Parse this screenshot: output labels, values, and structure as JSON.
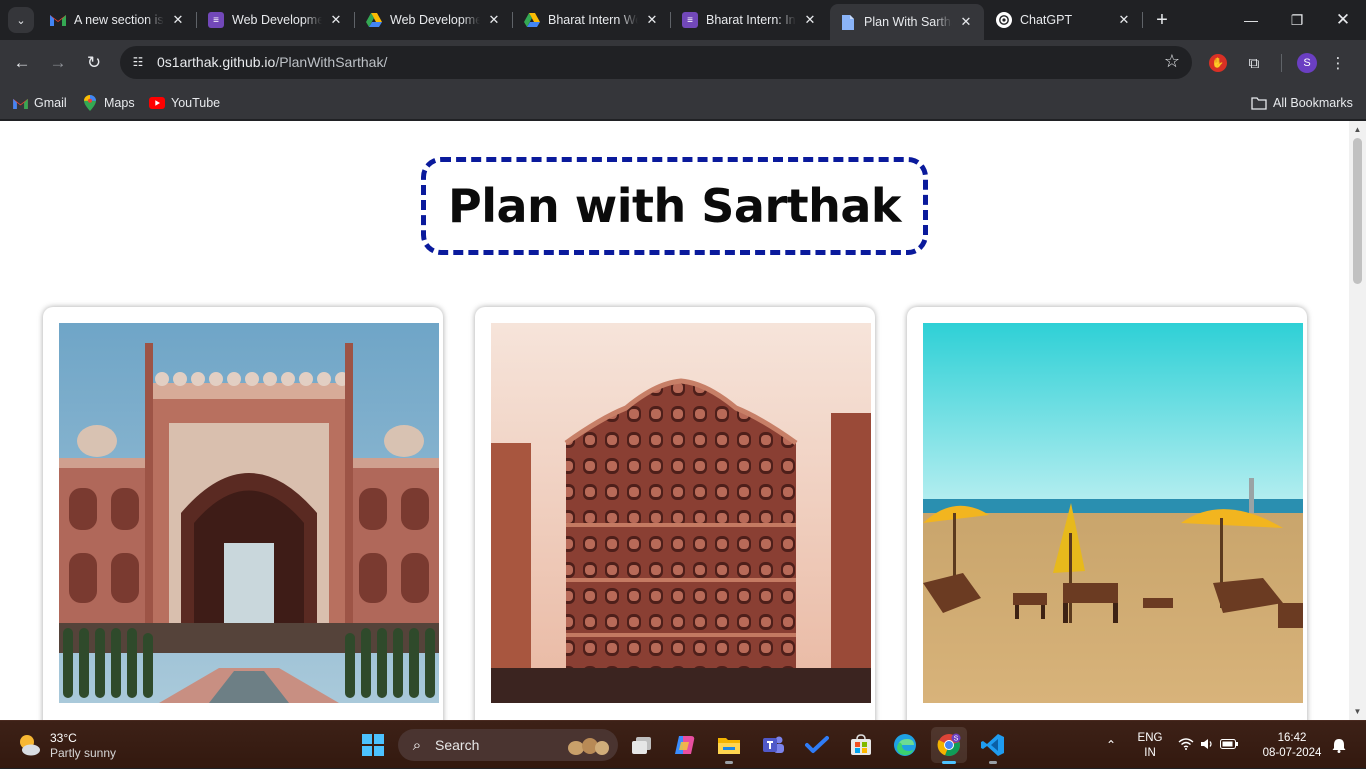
{
  "browser": {
    "tabs": [
      {
        "title": "A new section is",
        "icon": "gmail-icon",
        "active": false
      },
      {
        "title": "Web Developme",
        "icon": "forms-icon",
        "active": false
      },
      {
        "title": "Web Developme",
        "icon": "drive-icon",
        "active": false
      },
      {
        "title": "Bharat Intern We",
        "icon": "drive-icon",
        "active": false
      },
      {
        "title": "Bharat Intern: Int",
        "icon": "forms-icon",
        "active": false
      },
      {
        "title": "Plan With Sartha",
        "icon": "doc-icon",
        "active": true
      },
      {
        "title": "ChatGPT",
        "icon": "chatgpt-icon",
        "active": false
      }
    ],
    "address": {
      "host": "0s1arthak.github.io",
      "path": "/PlanWithSarthak/"
    },
    "profile_initial": "S",
    "bookmarks": [
      {
        "label": "Gmail",
        "icon": "gmail-icon"
      },
      {
        "label": "Maps",
        "icon": "maps-icon"
      },
      {
        "label": "YouTube",
        "icon": "youtube-icon"
      }
    ],
    "all_bookmarks": "All Bookmarks"
  },
  "page": {
    "title": "Plan with Sarthak",
    "title_border_color": "#0a1a9c",
    "cards": [
      {
        "image": "taj-mahal-gate-photo"
      },
      {
        "image": "hawa-mahal-photo"
      },
      {
        "image": "beach-umbrellas-photo"
      }
    ]
  },
  "taskbar": {
    "weather": {
      "temp": "33°C",
      "condition": "Partly sunny"
    },
    "search_label": "Search",
    "language": {
      "line1": "ENG",
      "line2": "IN"
    },
    "clock": {
      "time": "16:42",
      "date": "08-07-2024"
    },
    "apps": [
      "start-icon",
      "search",
      "task-view-icon",
      "copilot-icon",
      "file-explorer-icon",
      "teams-icon",
      "todo-icon",
      "store-icon",
      "edge-icon",
      "chrome-icon",
      "vscode-icon"
    ]
  }
}
